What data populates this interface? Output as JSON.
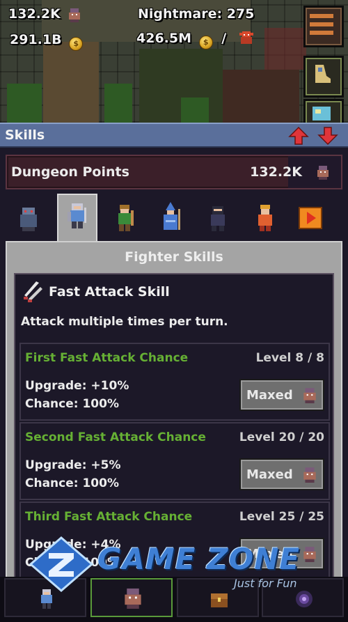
{
  "hud": {
    "dungeon_points": "132.2K",
    "gold": "291.1B",
    "difficulty": "Nightmare: 275",
    "gold_rate": "426.5M",
    "rate_separator": "/"
  },
  "header": {
    "title": "Skills"
  },
  "dungeon_points_bar": {
    "label": "Dungeon Points",
    "value": "132.2K"
  },
  "class_tabs": [
    "Class 1",
    "Fighter",
    "Class 3",
    "Class 4",
    "Class 5",
    "Class 6"
  ],
  "panel": {
    "title": "Fighter Skills"
  },
  "skill": {
    "name": "Fast Attack Skill",
    "description": "Attack multiple times per turn.",
    "upgrades": [
      {
        "name": "First Fast Attack Chance",
        "level": "Level 8 / 8",
        "upgrade": "Upgrade: +10%",
        "chance": "Chance: 100%",
        "button": "Maxed"
      },
      {
        "name": "Second Fast Attack Chance",
        "level": "Level 20 / 20",
        "upgrade": "Upgrade: +5%",
        "chance": "Chance: 100%",
        "button": "Maxed"
      },
      {
        "name": "Third Fast Attack Chance",
        "level": "Level 25 / 25",
        "upgrade": "Upgrade: +4%",
        "chance": "Chance: 100%",
        "button": "Maxed"
      }
    ]
  },
  "bottom_nav": [
    "heroes",
    "skills",
    "chest",
    "portal"
  ],
  "watermark": {
    "brand": "GAME ZONE",
    "tagline": "Just for Fun"
  },
  "colors": {
    "accent_green": "#66b034",
    "header_blue": "#5a6f9b",
    "panel_gray": "#a4a4a4",
    "arrow_red": "#e0353a"
  }
}
